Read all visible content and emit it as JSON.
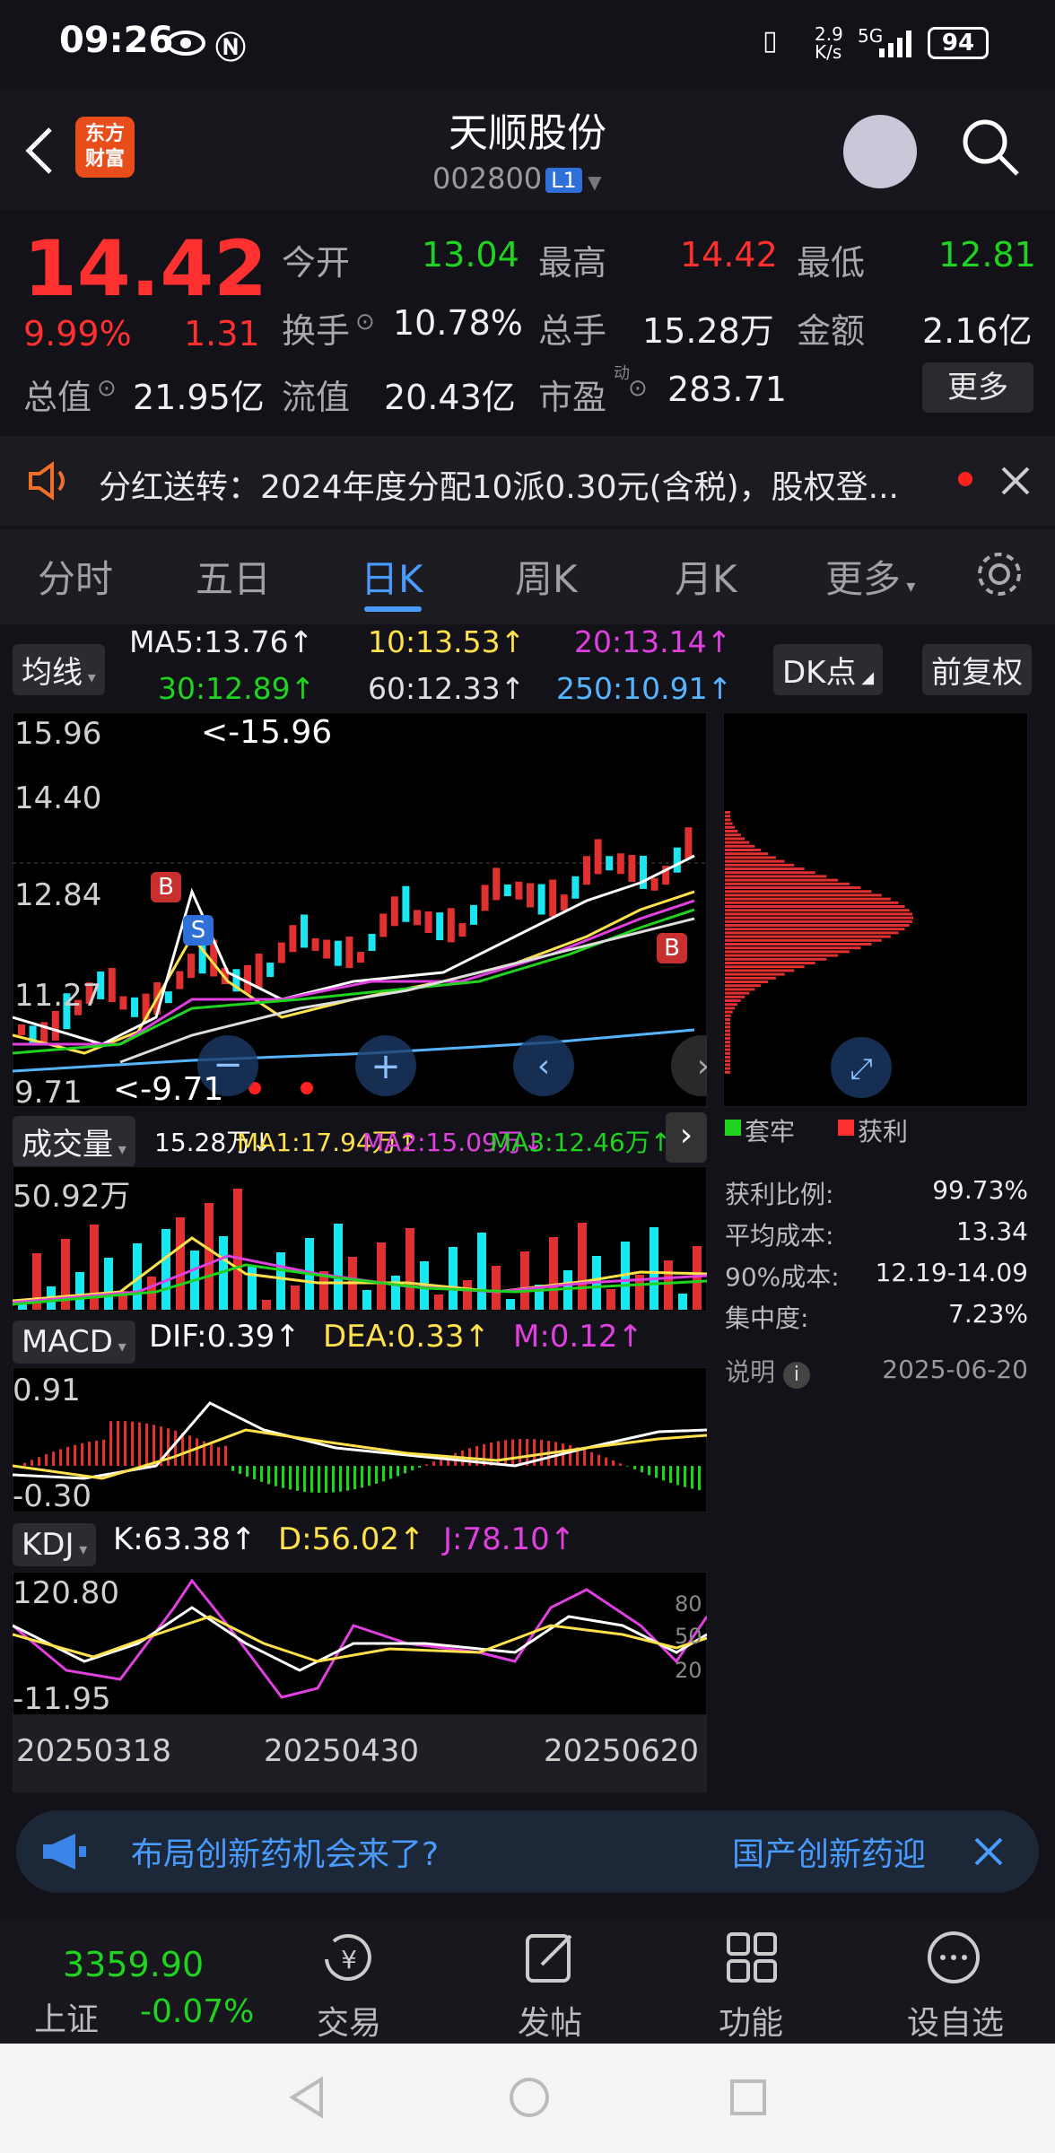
{
  "status": {
    "time": "09:26",
    "speed": "2.9\nK/s",
    "network": "5G",
    "battery": "94"
  },
  "header": {
    "title": "天顺股份",
    "code": "002800",
    "level": "L1",
    "logo_line1": "东方",
    "logo_line2": "财富"
  },
  "quote": {
    "price": "14.42",
    "pct": "9.99%",
    "change": "1.31",
    "open_label": "今开",
    "open": "13.04",
    "high_label": "最高",
    "high": "14.42",
    "low_label": "最低",
    "low": "12.81",
    "turnover_label": "换手",
    "turnover": "10.78%",
    "volume_label": "总手",
    "volume": "15.28万",
    "amount_label": "金额",
    "amount": "2.16亿",
    "mcap_label": "总值",
    "mcap": "21.95亿",
    "float_label": "流值",
    "float": "20.43亿",
    "pe_label": "市盈",
    "pe_sup": "动",
    "pe": "283.71",
    "more": "更多"
  },
  "notice": {
    "text": "分红送转：2024年度分配10派0.30元(含税)，股权登..."
  },
  "tabs": [
    "分时",
    "五日",
    "日K",
    "周K",
    "月K",
    "更多"
  ],
  "ma": {
    "chip": "均线",
    "ma5": "MA5:13.76↑",
    "ma10": "10:13.53↑",
    "ma20": "20:13.14↑",
    "ma30": "30:12.89↑",
    "ma60": "60:12.33↑",
    "ma250": "250:10.91↑",
    "dk": "DK点",
    "fq": "前复权"
  },
  "kline": {
    "y1": "15.96",
    "y2": "14.40",
    "y3": "12.84",
    "y4": "11.27",
    "y5": "9.71",
    "max_label": "<-15.96",
    "min_label": "<-9.71",
    "b1": "B",
    "s1": "S",
    "b2": "B"
  },
  "volume": {
    "chip": "成交量",
    "v": "15.28万↓",
    "ma1": "MA1:17.94万↑",
    "ma2": "MA2:15.09万↓",
    "ma3": "MA3:12.46万↑",
    "top": "50.92万"
  },
  "macd": {
    "chip": "MACD",
    "dif": "DIF:0.39↑",
    "dea": "DEA:0.33↑",
    "m": "M:0.12↑",
    "top": "0.91",
    "bottom": "-0.30"
  },
  "kdj": {
    "chip": "KDJ",
    "k": "K:63.38↑",
    "d": "D:56.02↑",
    "j": "J:78.10↑",
    "top": "120.80",
    "bottom": "-11.95",
    "t80": "80",
    "t50": "50",
    "t20": "20"
  },
  "dates": [
    "20250318",
    "20250430",
    "20250620"
  ],
  "chips": {
    "legend_trap": "套牢",
    "legend_profit": "获利",
    "rows": [
      [
        "获利比例:",
        "99.73%"
      ],
      [
        "平均成本:",
        "13.34"
      ],
      [
        "90%成本:",
        "12.19-14.09"
      ],
      [
        "集中度:",
        "7.23%"
      ]
    ],
    "note": "说明",
    "date": "2025-06-20"
  },
  "ad": {
    "text": "布局创新药机会来了?",
    "right": "国产创新药迎"
  },
  "bottom": {
    "index_value": "3359.90",
    "index_name": "上证",
    "index_chg": "-0.07%",
    "trade": "交易",
    "post": "发帖",
    "func": "功能",
    "watch": "设自选"
  },
  "colors": {
    "up": "#ff3030",
    "down": "#1fd31f",
    "cyan": "#19e6f0",
    "accent": "#4a9bff"
  }
}
